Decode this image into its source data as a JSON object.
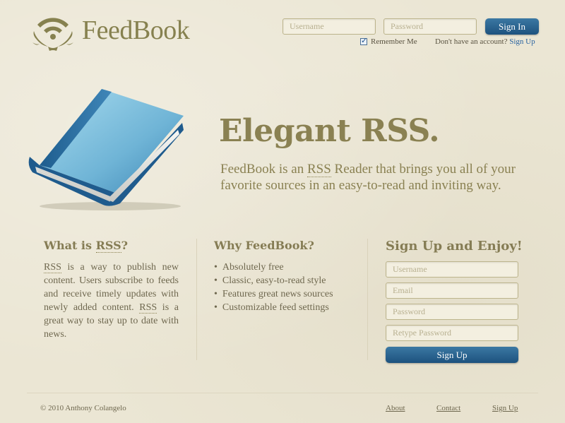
{
  "brand": {
    "name": "FeedBook"
  },
  "login": {
    "username_placeholder": "Username",
    "password_placeholder": "Password",
    "signin_label": "Sign In",
    "remember_label": "Remember Me",
    "no_account_text": "Don't have an account?",
    "signup_link": "Sign Up"
  },
  "hero": {
    "title": "Elegant RSS.",
    "text_before": "FeedBook is an ",
    "text_rss": "RSS",
    "text_after": " Reader that brings you all of your favorite sources in an easy-to-read and inviting way."
  },
  "what_is": {
    "heading_prefix": "What is ",
    "heading_rss": "RSS",
    "heading_suffix": "?",
    "p_rss1": "RSS",
    "p_part1": " is a way to publish new content. Users subscribe to feeds and receive timely updates with newly added content. ",
    "p_rss2": "RSS",
    "p_part2": " is a great way to stay up to date with news."
  },
  "why": {
    "heading": "Why FeedBook?",
    "items": [
      "Absolutely free",
      "Classic, easy-to-read style",
      "Features great news sources",
      "Customizable feed settings"
    ]
  },
  "signup": {
    "heading": "Sign Up and Enjoy!",
    "username_placeholder": "Username",
    "email_placeholder": "Email",
    "password_placeholder": "Password",
    "retype_placeholder": "Retype Password",
    "button_label": "Sign Up"
  },
  "footer": {
    "copyright": "© 2010 Anthony Colangelo",
    "links": [
      "About",
      "Contact",
      "Sign Up"
    ]
  },
  "icons": {
    "logo": "rss-wreath-icon",
    "book": "book-icon",
    "checkbox": "checkbox-checked-icon"
  },
  "colors": {
    "accent_blue": "#1d527e",
    "brand_olive": "#86814f",
    "background": "#ebe6d4"
  }
}
